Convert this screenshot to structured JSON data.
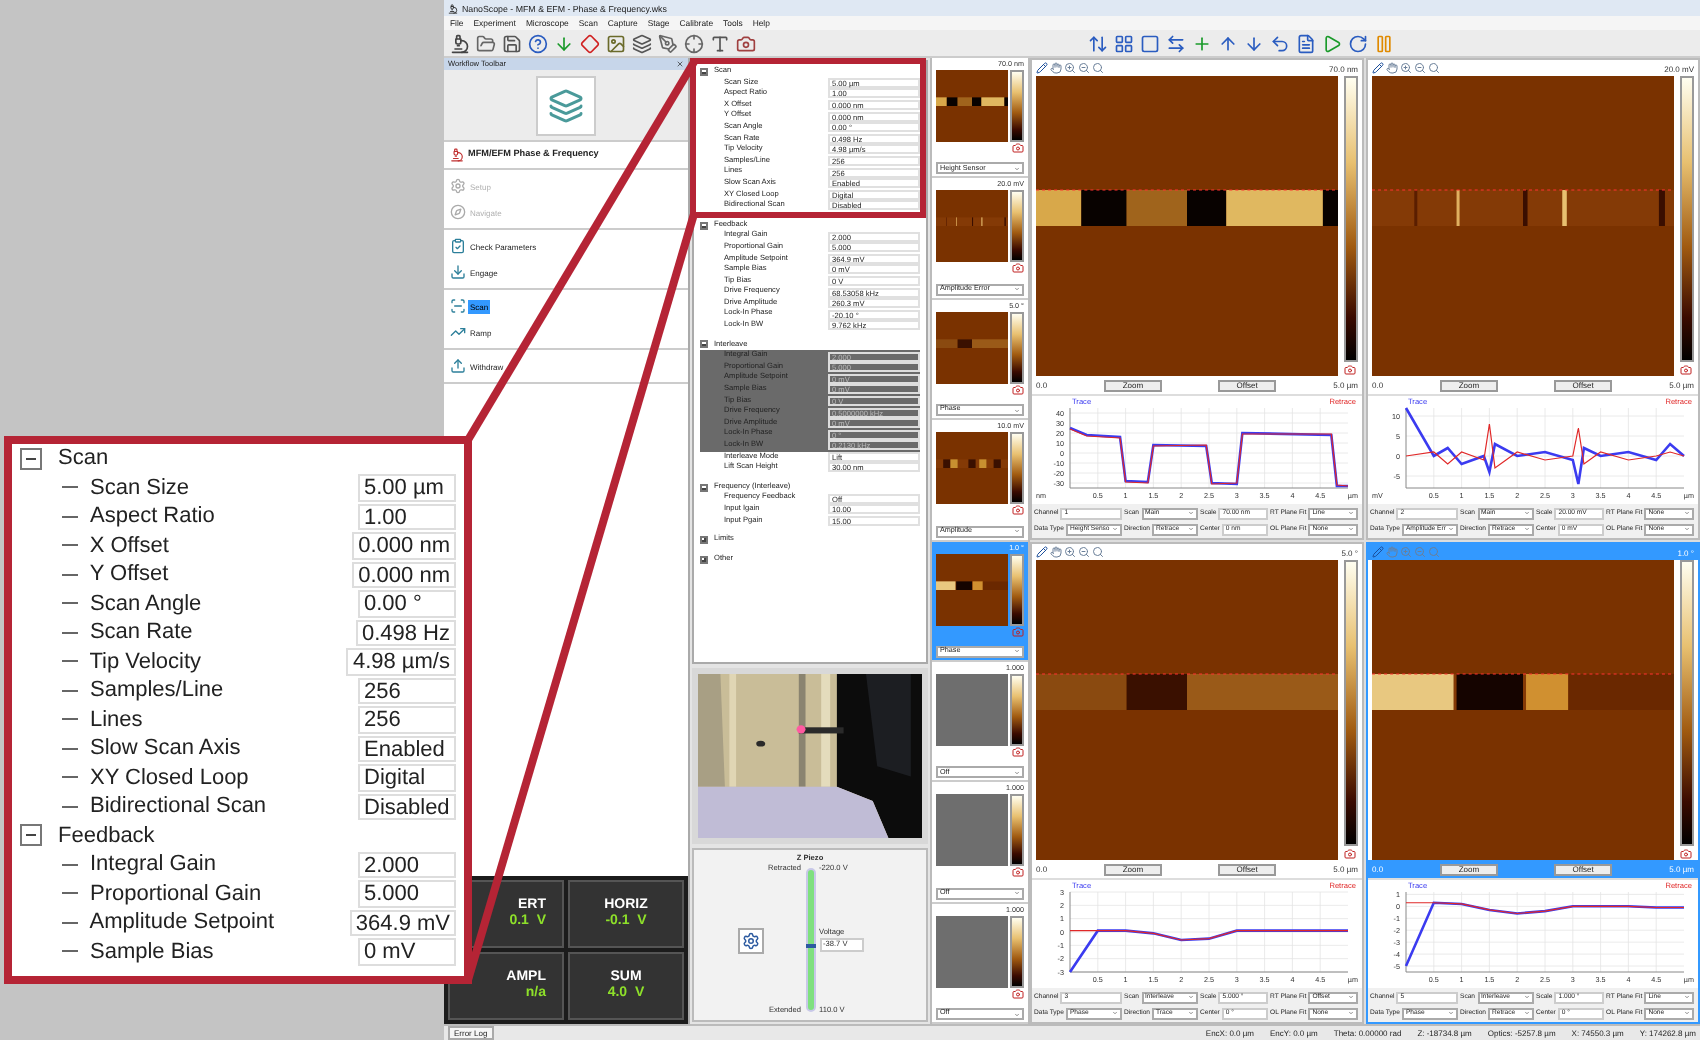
{
  "window": {
    "title": "NanoScope - MFM & EFM - Phase & Frequency.wks"
  },
  "menu": [
    "File",
    "Experiment",
    "Microscope",
    "Scan",
    "Capture",
    "Stage",
    "Calibrate",
    "Tools",
    "Help"
  ],
  "workflow": {
    "title": "Workflow Toolbar",
    "experiment": "MFM/EFM Phase & Frequency",
    "groups": [
      {
        "steps": [
          {
            "label": "Setup",
            "disabled": true,
            "selected": false
          },
          {
            "label": "Navigate",
            "disabled": true,
            "selected": false
          }
        ]
      },
      {
        "steps": [
          {
            "label": "Check Parameters",
            "disabled": false,
            "selected": false
          },
          {
            "label": "Engage",
            "disabled": false,
            "selected": false
          }
        ]
      },
      {
        "steps": [
          {
            "label": "Scan",
            "disabled": false,
            "selected": true
          },
          {
            "label": "Ramp",
            "disabled": false,
            "selected": false
          }
        ]
      },
      {
        "steps": [
          {
            "label": "Withdraw",
            "disabled": false,
            "selected": false
          }
        ]
      }
    ]
  },
  "meters": [
    {
      "label": "ERT",
      "reading": "0.1  V"
    },
    {
      "label": "HORIZ",
      "reading": "-0.1  V"
    },
    {
      "label": "AMPL",
      "reading": "n/a"
    },
    {
      "label": "SUM",
      "reading": "4.0  V"
    }
  ],
  "parameters": {
    "sections": [
      {
        "label": "Scan",
        "expanded": true,
        "rows": [
          {
            "label": "Scan Size",
            "value": "5.00 µm",
            "disabled": false
          },
          {
            "label": "Aspect Ratio",
            "value": "1.00",
            "disabled": false
          },
          {
            "label": "X Offset",
            "value": "0.000 nm",
            "disabled": false
          },
          {
            "label": "Y Offset",
            "value": "0.000 nm",
            "disabled": false
          },
          {
            "label": "Scan Angle",
            "value": "0.00 °",
            "disabled": false
          },
          {
            "label": "Scan Rate",
            "value": "0.498 Hz",
            "disabled": false
          },
          {
            "label": "Tip Velocity",
            "value": "4.98 µm/s",
            "disabled": false
          },
          {
            "label": "Samples/Line",
            "value": "256",
            "disabled": false
          },
          {
            "label": "Lines",
            "value": "256",
            "disabled": false
          },
          {
            "label": "Slow Scan Axis",
            "value": "Enabled",
            "disabled": false
          },
          {
            "label": "XY Closed Loop",
            "value": "Digital",
            "disabled": false
          },
          {
            "label": "Bidirectional Scan",
            "value": "Disabled",
            "disabled": false
          }
        ]
      },
      {
        "label": "Feedback",
        "expanded": true,
        "rows": [
          {
            "label": "Integral Gain",
            "value": "2.000",
            "disabled": false
          },
          {
            "label": "Proportional Gain",
            "value": "5.000",
            "disabled": false
          },
          {
            "label": "Amplitude Setpoint",
            "value": "364.9 mV",
            "disabled": false
          },
          {
            "label": "Sample Bias",
            "value": "0 mV",
            "disabled": false
          },
          {
            "label": "Tip Bias",
            "value": "0 V",
            "disabled": false
          },
          {
            "label": "Drive Frequency",
            "value": "68.53058 kHz",
            "disabled": false
          },
          {
            "label": "Drive Amplitude",
            "value": "260.3 mV",
            "disabled": false
          },
          {
            "label": "Lock-In Phase",
            "value": "-20.10 °",
            "disabled": false
          },
          {
            "label": "Lock-In BW",
            "value": "9.762 kHz",
            "disabled": false
          }
        ]
      },
      {
        "label": "Interleave",
        "expanded": true,
        "rows": [
          {
            "label": "Integral Gain",
            "value": "2.000",
            "disabled": true
          },
          {
            "label": "Proportional Gain",
            "value": "5.000",
            "disabled": true
          },
          {
            "label": "Amplitude Setpoint",
            "value": "0 mV",
            "disabled": true
          },
          {
            "label": "Sample Bias",
            "value": "0 mV",
            "disabled": true
          },
          {
            "label": "Tip Bias",
            "value": "0 V",
            "disabled": true
          },
          {
            "label": "Drive Frequency",
            "value": "0.5000000 kHz",
            "disabled": true
          },
          {
            "label": "Drive Amplitude",
            "value": "0 mV",
            "disabled": true
          },
          {
            "label": "Lock-In Phase",
            "value": "0 °",
            "disabled": true
          },
          {
            "label": "Lock-In BW",
            "value": "0.2130 kHz",
            "disabled": true
          },
          {
            "label": "Interleave Mode",
            "value": "Lift",
            "disabled": false
          },
          {
            "label": "Lift Scan Height",
            "value": "30.00 nm",
            "disabled": false
          }
        ]
      },
      {
        "label": "Frequency (Interleave)",
        "expanded": true,
        "rows": [
          {
            "label": "Frequency Feedback",
            "value": "Off",
            "disabled": false
          },
          {
            "label": "Input Igain",
            "value": "10.00",
            "disabled": false
          },
          {
            "label": "Input Pgain",
            "value": "15.00",
            "disabled": false
          }
        ]
      },
      {
        "label": "Limits",
        "expanded": false
      },
      {
        "label": "Other",
        "expanded": false
      }
    ]
  },
  "z_piezo": {
    "title": "Z Piezo",
    "top_label": "Retracted",
    "top_value": "-220.0 V",
    "voltage_label": "Voltage",
    "voltage": "-38.7 V",
    "bottom_label": "Extended",
    "bottom_value": "110.0 V",
    "level": 0.45
  },
  "thumbnails": [
    {
      "scale": "70.0 nm",
      "channel": "Height Sensor",
      "kind": "scan",
      "selected": false
    },
    {
      "scale": "20.0 mV",
      "channel": "Amplitude Error",
      "kind": "scan",
      "selected": false
    },
    {
      "scale": "5.0 °",
      "channel": "Phase",
      "kind": "scan",
      "selected": false
    },
    {
      "scale": "10.0 mV",
      "channel": "Amplitude",
      "kind": "scan",
      "selected": false
    },
    {
      "scale": "1.0 °",
      "channel": "Phase",
      "kind": "scan",
      "selected": true
    },
    {
      "scale": "1.000",
      "channel": "Off",
      "kind": "empty",
      "selected": false
    },
    {
      "scale": "1.000",
      "channel": "Off",
      "kind": "empty",
      "selected": false
    },
    {
      "scale": "1.000",
      "channel": "Off",
      "kind": "empty",
      "selected": false
    }
  ],
  "panels": [
    {
      "scale": "70.0 nm",
      "selected": false,
      "x_start": "0.0",
      "x_end": "5.0 µm",
      "zoom": "Zoom",
      "offset": "Offset",
      "chart_data": {
        "type": "line",
        "grid": true,
        "xlabel": "µm",
        "ylabel": "nm",
        "x": [
          0,
          0.3,
          0.9,
          1.0,
          1.4,
          1.5,
          2.45,
          2.55,
          3.0,
          3.1,
          4.7,
          4.8,
          5.0
        ],
        "xlim": [
          0,
          5
        ],
        "ylim": [
          -35,
          45
        ],
        "xticks": [
          0.5,
          1,
          1.5,
          2,
          2.5,
          3,
          3.5,
          4,
          4.5
        ],
        "yticks": [
          40,
          30,
          20,
          10,
          0,
          -10,
          -20,
          -30
        ],
        "series": [
          {
            "name": "Trace",
            "color": "#3b3bf0",
            "values": [
              25,
              18,
              16,
              -28,
              -29,
              8,
              7,
              -30,
              -31,
              20,
              18,
              -33,
              -33
            ]
          },
          {
            "name": "Retrace",
            "color": "#e02828",
            "values": [
              24,
              17,
              15,
              -29,
              -30,
              7,
              8,
              -31,
              -30,
              19,
              19,
              -32,
              -33
            ]
          }
        ]
      },
      "controls": [
        {
          "label": "Channel",
          "value": "1",
          "kind": "field"
        },
        {
          "label": "Scan",
          "value": "Main",
          "kind": "dropdown"
        },
        {
          "label": "Scale",
          "value": "70.00 nm",
          "kind": "field"
        },
        {
          "label": "RT Plane Fit",
          "value": "Line",
          "kind": "dropdown"
        },
        {
          "label": "Data Type",
          "value": "Height Senso",
          "kind": "dropdown"
        },
        {
          "label": "Direction",
          "value": "Retrace",
          "kind": "dropdown"
        },
        {
          "label": "Center",
          "value": "0 nm",
          "kind": "field"
        },
        {
          "label": "OL Plane Fit",
          "value": "None",
          "kind": "dropdown"
        }
      ]
    },
    {
      "scale": "20.0 mV",
      "selected": false,
      "x_start": "0.0",
      "x_end": "5.0 µm",
      "zoom": "Zoom",
      "offset": "Offset",
      "chart_data": {
        "type": "line",
        "grid": true,
        "xlabel": "µm",
        "ylabel": "mV",
        "x": [
          0,
          0.5,
          0.75,
          1.0,
          1.4,
          1.5,
          1.6,
          2.0,
          2.5,
          3.0,
          3.1,
          3.2,
          3.5,
          4.0,
          4.5,
          4.75,
          5.0
        ],
        "xlim": [
          0,
          5
        ],
        "ylim": [
          -8,
          12
        ],
        "xticks": [
          0.5,
          1,
          1.5,
          2,
          2.5,
          3,
          3.5,
          4,
          4.5
        ],
        "yticks": [
          10,
          5,
          0,
          -5
        ],
        "series": [
          {
            "name": "Trace",
            "color": "#3b3bf0",
            "values": [
              12,
              0,
              2,
              -2,
              0,
              -4,
              3,
              0,
              1,
              -1,
              -7,
              2,
              0,
              1,
              -1,
              3,
              0
            ]
          },
          {
            "name": "Retrace",
            "color": "#e02828",
            "values": [
              0,
              1,
              -2,
              1,
              -1,
              8,
              -3,
              1,
              -1,
              0,
              7,
              -2,
              1,
              -1,
              0,
              1,
              0
            ]
          }
        ]
      },
      "controls": [
        {
          "label": "Channel",
          "value": "2",
          "kind": "field"
        },
        {
          "label": "Scan",
          "value": "Main",
          "kind": "dropdown"
        },
        {
          "label": "Scale",
          "value": "20.00 mV",
          "kind": "field"
        },
        {
          "label": "RT Plane Fit",
          "value": "None",
          "kind": "dropdown"
        },
        {
          "label": "Data Type",
          "value": "Amplitude Err",
          "kind": "dropdown"
        },
        {
          "label": "Direction",
          "value": "Retrace",
          "kind": "dropdown"
        },
        {
          "label": "Center",
          "value": "0 mV",
          "kind": "field"
        },
        {
          "label": "OL Plane Fit",
          "value": "None",
          "kind": "dropdown"
        }
      ]
    },
    {
      "scale": "5.0 °",
      "selected": false,
      "x_start": "0.0",
      "x_end": "5.0 µm",
      "zoom": "Zoom",
      "offset": "Offset",
      "chart_data": {
        "type": "line",
        "grid": true,
        "xlabel": "µm",
        "x": [
          0,
          0.5,
          1,
          1.5,
          2,
          2.5,
          3,
          3.5,
          4,
          4.5,
          5
        ],
        "xlim": [
          0,
          5
        ],
        "ylim": [
          -3,
          3
        ],
        "xticks": [
          0.5,
          1,
          1.5,
          2,
          2.5,
          3,
          3.5,
          4,
          4.5
        ],
        "yticks": [
          3,
          2,
          1,
          0,
          -1,
          -2,
          -3
        ],
        "series": [
          {
            "name": "Trace",
            "color": "#3b3bf0",
            "values": [
              -3,
              0.1,
              0.1,
              -0.1,
              -0.6,
              -0.5,
              0.1,
              0.1,
              0.1,
              0.1,
              0.1
            ]
          },
          {
            "name": "Retrace",
            "color": "#e02828",
            "values": [
              0.1,
              0.1,
              0.1,
              -0.1,
              -0.6,
              -0.5,
              0.1,
              0.1,
              0.1,
              0.1,
              0.1
            ]
          }
        ]
      },
      "controls": [
        {
          "label": "Channel",
          "value": "3",
          "kind": "field"
        },
        {
          "label": "Scan",
          "value": "Interleave",
          "kind": "dropdown"
        },
        {
          "label": "Scale",
          "value": "5.000 °",
          "kind": "field"
        },
        {
          "label": "RT Plane Fit",
          "value": "Offset",
          "kind": "dropdown"
        },
        {
          "label": "Data Type",
          "value": "Phase",
          "kind": "dropdown"
        },
        {
          "label": "Direction",
          "value": "Trace",
          "kind": "dropdown"
        },
        {
          "label": "Center",
          "value": "0 °",
          "kind": "field"
        },
        {
          "label": "OL Plane Fit",
          "value": "None",
          "kind": "dropdown"
        }
      ]
    },
    {
      "scale": "1.0 °",
      "selected": true,
      "x_start": "0.0",
      "x_end": "5.0 µm",
      "zoom": "Zoom",
      "offset": "Offset",
      "chart_data": {
        "type": "line",
        "grid": true,
        "xlabel": "µm",
        "x": [
          0,
          0.5,
          1,
          1.5,
          2,
          2.5,
          3,
          3.5,
          4,
          4.5,
          5
        ],
        "xlim": [
          0,
          5
        ],
        "ylim": [
          -5.5,
          1.2
        ],
        "xticks": [
          0.5,
          1,
          1.5,
          2,
          2.5,
          3,
          3.5,
          4,
          4.5
        ],
        "yticks": [
          1,
          0,
          -1,
          -2,
          -3,
          -4,
          -5
        ],
        "series": [
          {
            "name": "Trace",
            "color": "#3b3bf0",
            "values": [
              -5,
              0.3,
              0.2,
              -0.3,
              -0.6,
              -0.4,
              0,
              0,
              0,
              -0.1,
              -0.1
            ]
          },
          {
            "name": "Retrace",
            "color": "#e02828",
            "values": [
              0.3,
              0.3,
              0.2,
              -0.3,
              -0.6,
              -0.4,
              0,
              0,
              0,
              -0.1,
              -0.1
            ]
          }
        ]
      },
      "controls": [
        {
          "label": "Channel",
          "value": "5",
          "kind": "field"
        },
        {
          "label": "Scan",
          "value": "Interleave",
          "kind": "dropdown"
        },
        {
          "label": "Scale",
          "value": "1.000 °",
          "kind": "field"
        },
        {
          "label": "RT Plane Fit",
          "value": "Line",
          "kind": "dropdown"
        },
        {
          "label": "Data Type",
          "value": "Phase",
          "kind": "dropdown"
        },
        {
          "label": "Direction",
          "value": "Retrace",
          "kind": "dropdown"
        },
        {
          "label": "Center",
          "value": "0 °",
          "kind": "field"
        },
        {
          "label": "OL Plane Fit",
          "value": "None",
          "kind": "dropdown"
        }
      ]
    }
  ],
  "status_bar": {
    "error_log": "Error Log",
    "fields": [
      "EncX: 0.0 µm",
      "EncY: 0.0 µm",
      "Theta: 0.00000 rad",
      "Z: -18734.8 µm",
      "Optics: -5257.8 µm",
      "X: 74550.3 µm",
      "Y: 174262.8 µm"
    ]
  },
  "callout": {
    "sections": [
      {
        "label": "Scan",
        "expanded": true,
        "rows": [
          {
            "label": "Scan Size",
            "value": "5.00 µm"
          },
          {
            "label": "Aspect Ratio",
            "value": "1.00"
          },
          {
            "label": "X Offset",
            "value": "0.000 nm"
          },
          {
            "label": "Y Offset",
            "value": "0.000 nm"
          },
          {
            "label": "Scan Angle",
            "value": "0.00 °"
          },
          {
            "label": "Scan Rate",
            "value": "0.498 Hz"
          },
          {
            "label": "Tip Velocity",
            "value": "4.98 µm/s"
          },
          {
            "label": "Samples/Line",
            "value": "256"
          },
          {
            "label": "Lines",
            "value": "256"
          },
          {
            "label": "Slow Scan Axis",
            "value": "Enabled"
          },
          {
            "label": "XY Closed Loop",
            "value": "Digital"
          },
          {
            "label": "Bidirectional Scan",
            "value": "Disabled"
          }
        ]
      },
      {
        "label": "Feedback",
        "expanded": true,
        "rows": [
          {
            "label": "Integral Gain",
            "value": "2.000"
          },
          {
            "label": "Proportional Gain",
            "value": "5.000"
          },
          {
            "label": "Amplitude Setpoint",
            "value": "364.9 mV"
          },
          {
            "label": "Sample Bias",
            "value": "0 mV"
          }
        ]
      }
    ]
  }
}
